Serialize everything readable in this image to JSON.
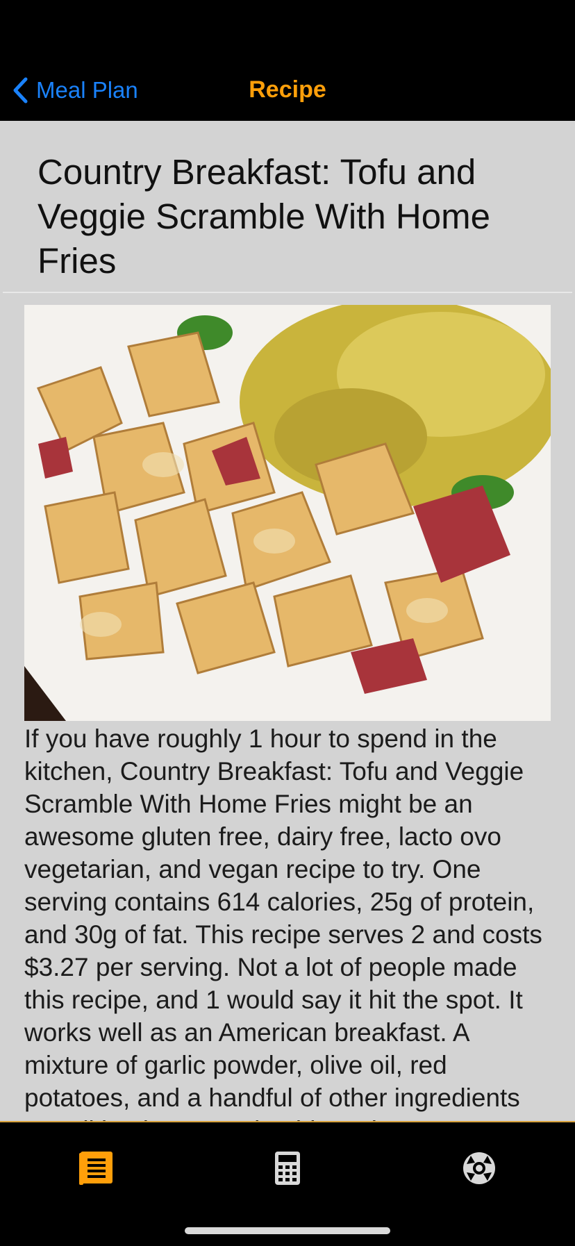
{
  "nav": {
    "back_label": "Meal Plan",
    "title": "Recipe"
  },
  "recipe": {
    "title": "Country Breakfast: Tofu and Veggie Scramble With Home Fries",
    "image_alt": "Home fries with tofu scramble",
    "description": "If you have roughly 1 hour to spend in the kitchen, Country Breakfast: Tofu and Veggie Scramble With Home Fries might be an awesome gluten free, dairy free, lacto ovo vegetarian, and vegan recipe to try. One serving contains 614 calories, 25g of protein, and 30g of fat. This recipe serves 2 and costs $3.27 per serving. Not a lot of people made this recipe, and 1 would say it hit the spot. It works well as an American breakfast. A mixture of garlic powder, olive oil, red potatoes, and a handful of other ingredients are all it takes to make this recipe so tasty."
  },
  "tabs": [
    {
      "icon": "recipe-list-icon",
      "active": true
    },
    {
      "icon": "calculator-icon",
      "active": false
    },
    {
      "icon": "help-lifebuoy-icon",
      "active": false
    }
  ],
  "colors": {
    "accent": "#ff9f0a",
    "link": "#1a82fb",
    "content_bg": "#d3d3d3"
  }
}
